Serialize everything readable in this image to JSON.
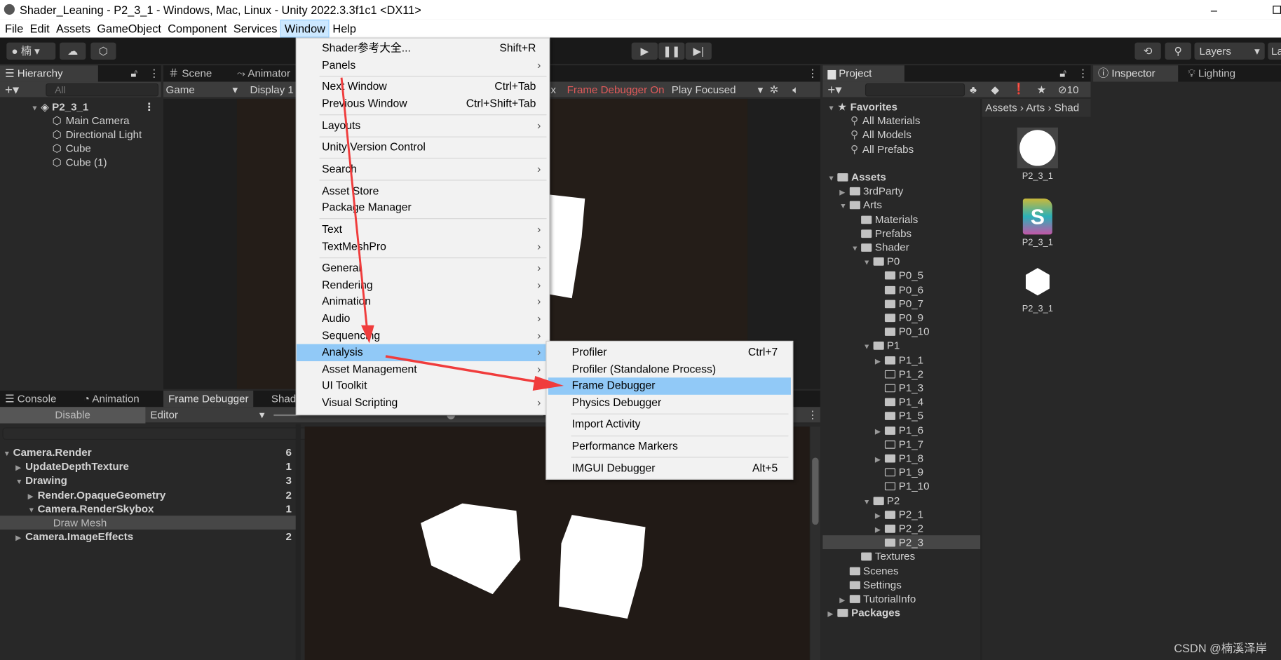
{
  "window": {
    "title": "Shader_Leaning - P2_3_1 - Windows, Mac, Linux - Unity 2022.3.3f1c1 <DX11>",
    "minimize": "–"
  },
  "menubar": [
    "File",
    "Edit",
    "Assets",
    "GameObject",
    "Component",
    "Services",
    "Window",
    "Help"
  ],
  "toolbar": {
    "account": "楠",
    "layers": "Layers",
    "layout": "La"
  },
  "hierarchy": {
    "tab": "Hierarchy",
    "search_placeholder": "All",
    "scene": "P2_3_1",
    "items": [
      "Main Camera",
      "Directional Light",
      "Cube",
      "Cube (1)"
    ]
  },
  "scene_panel": {
    "tabs": [
      "Scene",
      "Animator"
    ],
    "game_label": "Game",
    "display": "Display 1",
    "scale_suffix": "x",
    "frame_debugger_status": "Frame Debugger On",
    "play_mode": "Play Focused",
    "frame_debugger_color": "#e05a5a"
  },
  "window_menu": {
    "items": [
      {
        "label": "Shader参考大全...",
        "shortcut": "Shift+R"
      },
      {
        "label": "Panels",
        "submenu": true
      },
      {
        "sep": true
      },
      {
        "label": "Next Window",
        "shortcut": "Ctrl+Tab"
      },
      {
        "label": "Previous Window",
        "shortcut": "Ctrl+Shift+Tab"
      },
      {
        "sep": true
      },
      {
        "label": "Layouts",
        "submenu": true
      },
      {
        "sep": true
      },
      {
        "label": "Unity Version Control"
      },
      {
        "sep": true
      },
      {
        "label": "Search",
        "submenu": true
      },
      {
        "sep": true
      },
      {
        "label": "Asset Store"
      },
      {
        "label": "Package Manager"
      },
      {
        "sep": true
      },
      {
        "label": "Text",
        "submenu": true
      },
      {
        "label": "TextMeshPro",
        "submenu": true
      },
      {
        "sep": true
      },
      {
        "label": "General",
        "submenu": true
      },
      {
        "label": "Rendering",
        "submenu": true
      },
      {
        "label": "Animation",
        "submenu": true
      },
      {
        "label": "Audio",
        "submenu": true
      },
      {
        "label": "Sequencing",
        "submenu": true
      },
      {
        "label": "Analysis",
        "submenu": true,
        "highlighted": true
      },
      {
        "label": "Asset Management",
        "submenu": true
      },
      {
        "label": "UI Toolkit",
        "submenu": true
      },
      {
        "label": "Visual Scripting",
        "submenu": true
      }
    ]
  },
  "analysis_submenu": {
    "items": [
      {
        "label": "Profiler",
        "shortcut": "Ctrl+7"
      },
      {
        "label": "Profiler (Standalone Process)"
      },
      {
        "label": "Frame Debugger",
        "highlighted": true
      },
      {
        "label": "Physics Debugger"
      },
      {
        "sep": true
      },
      {
        "label": "Import Activity"
      },
      {
        "sep": true
      },
      {
        "label": "Performance Markers"
      },
      {
        "sep": true
      },
      {
        "label": "IMGUI Debugger",
        "shortcut": "Alt+5"
      }
    ]
  },
  "bottom_panel": {
    "tabs": [
      "Console",
      "Animation",
      "Frame Debugger",
      "Shad"
    ],
    "disable_button": "Disable",
    "target": "Editor",
    "events": [
      {
        "label": "Camera.Render",
        "count": "6",
        "depth": 0,
        "expanded": true
      },
      {
        "label": "UpdateDepthTexture",
        "count": "1",
        "depth": 1,
        "expanded": false
      },
      {
        "label": "Drawing",
        "count": "3",
        "depth": 1,
        "expanded": true
      },
      {
        "label": "Render.OpaqueGeometry",
        "count": "2",
        "depth": 2,
        "expanded": false
      },
      {
        "label": "Camera.RenderSkybox",
        "count": "1",
        "depth": 2,
        "expanded": true
      },
      {
        "label": "Draw Mesh",
        "count": "",
        "depth": 3,
        "leaf": true,
        "selected": true
      },
      {
        "label": "Camera.ImageEffects",
        "count": "2",
        "depth": 1,
        "expanded": false
      }
    ]
  },
  "project": {
    "tab": "Project",
    "hidden_count": "10",
    "breadcrumb": [
      "Assets",
      "Arts",
      "Shad"
    ],
    "favorites": {
      "label": "Favorites",
      "items": [
        "All Materials",
        "All Models",
        "All Prefabs"
      ]
    },
    "tree": [
      {
        "label": "Assets",
        "d": 0,
        "a": "open",
        "bold": true
      },
      {
        "label": "3rdParty",
        "d": 1,
        "a": "closed"
      },
      {
        "label": "Arts",
        "d": 1,
        "a": "open"
      },
      {
        "label": "Materials",
        "d": 2
      },
      {
        "label": "Prefabs",
        "d": 2
      },
      {
        "label": "Shader",
        "d": 2,
        "a": "open"
      },
      {
        "label": "P0",
        "d": 3,
        "a": "open"
      },
      {
        "label": "P0_5",
        "d": 4
      },
      {
        "label": "P0_6",
        "d": 4
      },
      {
        "label": "P0_7",
        "d": 4
      },
      {
        "label": "P0_9",
        "d": 4
      },
      {
        "label": "P0_10",
        "d": 4
      },
      {
        "label": "P1",
        "d": 3,
        "a": "open"
      },
      {
        "label": "P1_1",
        "d": 4,
        "a": "closed"
      },
      {
        "label": "P1_2",
        "d": 4,
        "empty": true
      },
      {
        "label": "P1_3",
        "d": 4,
        "empty": true
      },
      {
        "label": "P1_4",
        "d": 4
      },
      {
        "label": "P1_5",
        "d": 4
      },
      {
        "label": "P1_6",
        "d": 4,
        "a": "closed"
      },
      {
        "label": "P1_7",
        "d": 4,
        "empty": true
      },
      {
        "label": "P1_8",
        "d": 4,
        "a": "closed"
      },
      {
        "label": "P1_9",
        "d": 4,
        "empty": true
      },
      {
        "label": "P1_10",
        "d": 4,
        "empty": true
      },
      {
        "label": "P2",
        "d": 3,
        "a": "open"
      },
      {
        "label": "P2_1",
        "d": 4,
        "a": "closed"
      },
      {
        "label": "P2_2",
        "d": 4,
        "a": "closed"
      },
      {
        "label": "P2_3",
        "d": 4,
        "selected": true
      },
      {
        "label": "Textures",
        "d": 2
      },
      {
        "label": "Scenes",
        "d": 1
      },
      {
        "label": "Settings",
        "d": 1
      },
      {
        "label": "TutorialInfo",
        "d": 1,
        "a": "closed"
      },
      {
        "label": "Packages",
        "d": 0,
        "a": "closed",
        "bold": true
      }
    ],
    "assets": [
      {
        "name": "P2_3_1",
        "icon": "material-sphere-icon"
      },
      {
        "name": "P2_3_1",
        "icon": "shader-icon"
      },
      {
        "name": "P2_3_1",
        "icon": "unity-prefab-icon"
      }
    ]
  },
  "inspector": {
    "tabs": [
      "Inspector",
      "Lighting"
    ]
  },
  "annotation": {
    "arrow_color": "#f03c3c"
  },
  "watermark": "CSDN @楠溪泽岸"
}
